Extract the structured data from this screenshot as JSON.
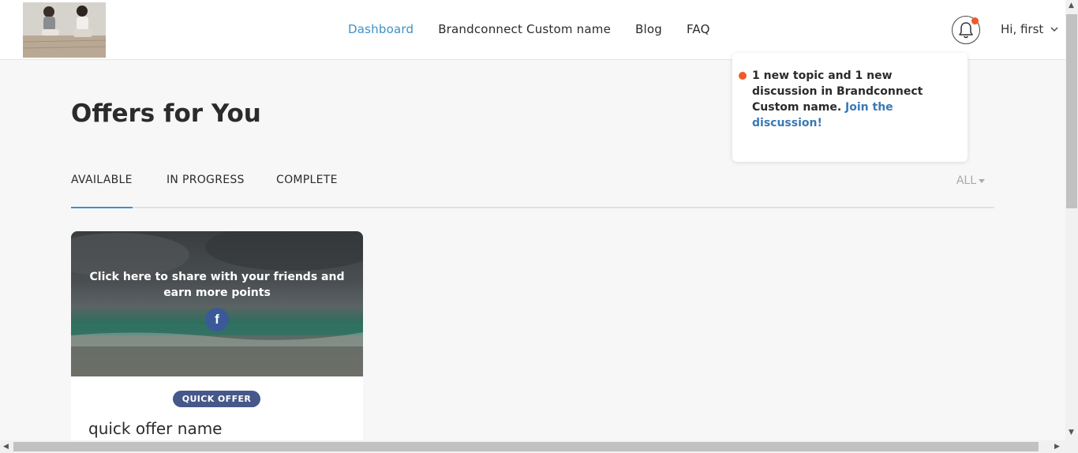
{
  "nav": {
    "items": [
      "Dashboard",
      "Brandconnect Custom name",
      "Blog",
      "FAQ"
    ],
    "active_index": 0
  },
  "user": {
    "greeting": "Hi, first"
  },
  "notification": {
    "message": "1 new topic and 1 new discussion in Brandconnect Custom name.",
    "link": "Join the discussion!"
  },
  "page": {
    "title": "Offers for You"
  },
  "tabs": {
    "items": [
      "AVAILABLE",
      "IN PROGRESS",
      "COMPLETE"
    ],
    "active_index": 0,
    "filter_label": "ALL"
  },
  "card": {
    "share_text": "Click here to share with your friends and earn more points",
    "badge": "QUICK OFFER",
    "name": "quick offer name",
    "facebook_icon": "f"
  },
  "colors": {
    "accent": "#3a93c9",
    "notification_dot": "#f05a28",
    "badge_bg": "#46588a",
    "facebook": "#3b5998"
  }
}
